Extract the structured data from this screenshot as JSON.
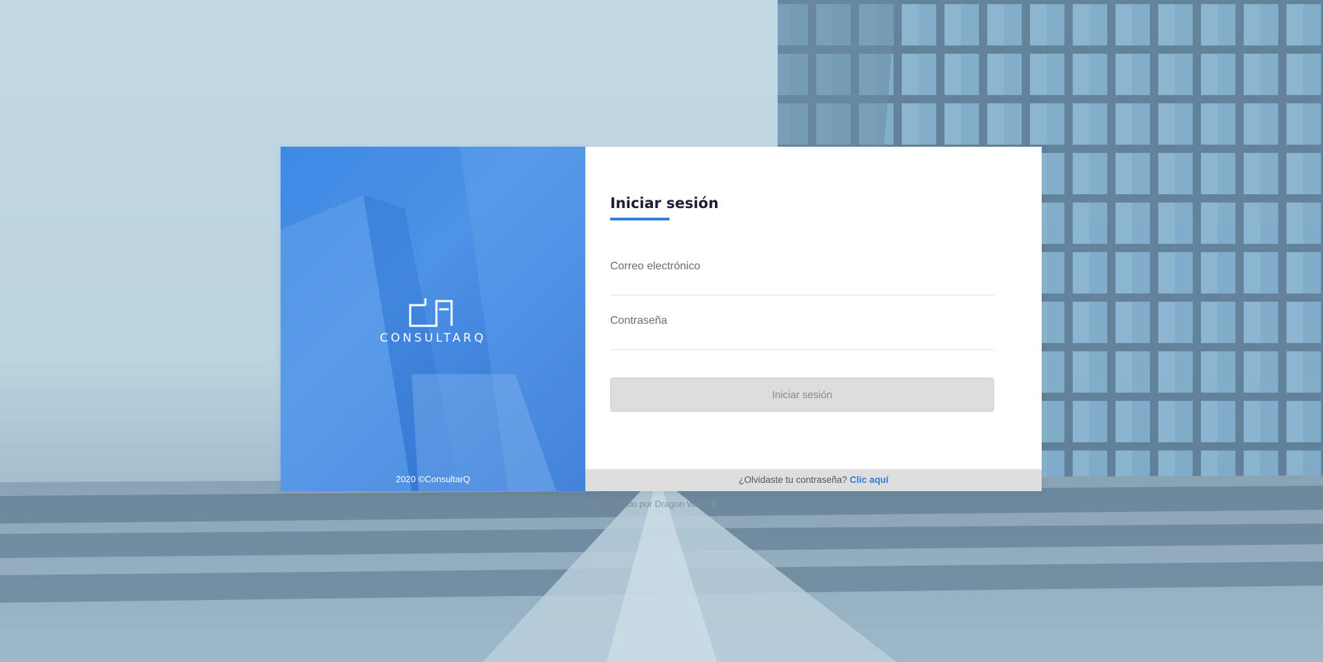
{
  "brand": {
    "logo_text": "CONSULTARQ",
    "copyright": "2020 ©ConsultarQ"
  },
  "login": {
    "title": "Iniciar sesión",
    "email_label": "Correo electrónico",
    "email_value": "",
    "password_label": "Contraseña",
    "password_value": "",
    "submit_label": "Iniciar sesión"
  },
  "forgot": {
    "text": "¿Olvidaste tu contraseña?",
    "link_label": "Clic aquí"
  },
  "footer": {
    "credit": "Desarrollado por Dragon Ware"
  },
  "colors": {
    "accent": "#2f7ed8",
    "brand_panel": "#3a86e0",
    "button_disabled": "#dcdcdc",
    "forgot_bar": "#dedede"
  },
  "icons": {
    "logo": "consultarq-logo-mark",
    "credit": "paper-plane-icon"
  }
}
